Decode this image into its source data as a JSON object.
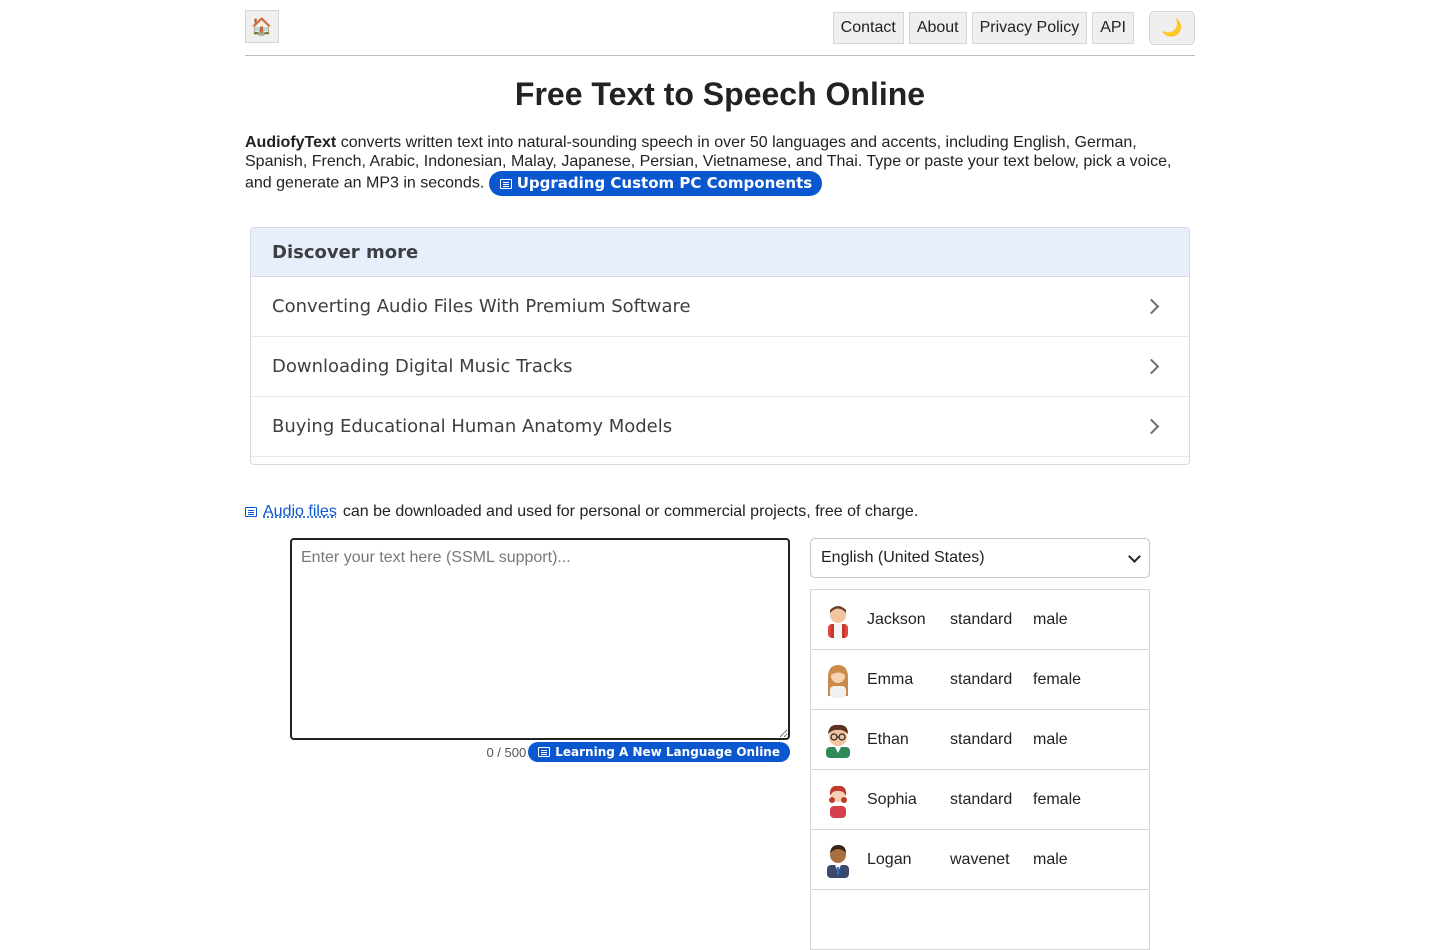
{
  "header": {
    "home_icon": "🏠",
    "links": [
      "Contact",
      "About",
      "Privacy Policy",
      "API"
    ],
    "theme_icon": "🌙"
  },
  "title": "Free Text to Speech Online",
  "intro": {
    "brand": "AudiofyText",
    "text": " converts written text into natural-sounding speech in over 50 languages and accents, including English, German, Spanish, French, Arabic, Indonesian, Malay, Japanese, Persian, Vietnamese, and Thai. Type or paste your text below, pick a voice, and generate an MP3 in seconds. ",
    "pill_label": "Upgrading Custom PC Components"
  },
  "discover": {
    "heading": "Discover more",
    "items": [
      "Converting Audio Files With Premium Software",
      "Downloading Digital Music Tracks",
      "Buying Educational Human Anatomy Models"
    ]
  },
  "note": {
    "link": "Audio files",
    "text": "can be downloaded and used for personal or commercial projects, free of charge."
  },
  "editor": {
    "placeholder": "Enter your text here (SSML support)...",
    "counter": "0 / 500",
    "pill_label": "Learning A New Language Online"
  },
  "language": {
    "selected": "English (United States)"
  },
  "voices": [
    {
      "name": "Jackson",
      "type": "standard",
      "gender": "male",
      "avatar": "male-avatar-red"
    },
    {
      "name": "Emma",
      "type": "standard",
      "gender": "female",
      "avatar": "female-avatar-blonde"
    },
    {
      "name": "Ethan",
      "type": "standard",
      "gender": "male",
      "avatar": "male-avatar-glasses"
    },
    {
      "name": "Sophia",
      "type": "standard",
      "gender": "female",
      "avatar": "female-avatar-red"
    },
    {
      "name": "Logan",
      "type": "wavenet",
      "gender": "male",
      "avatar": "male-avatar-suit"
    }
  ],
  "colors": {
    "accent": "#0b57d0",
    "discover_header": "#e8effc"
  }
}
